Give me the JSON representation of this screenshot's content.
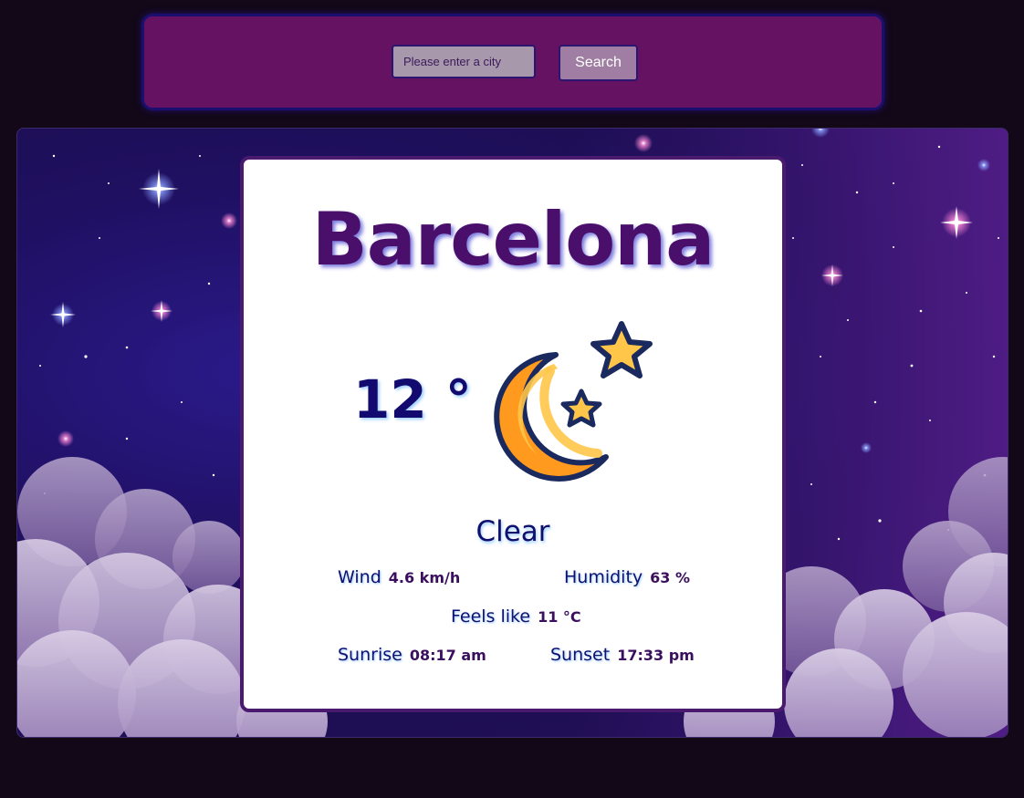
{
  "search": {
    "placeholder": "Please enter a city",
    "value": "",
    "button_label": "Search"
  },
  "weather": {
    "city": "Barcelona",
    "temperature": "12 °",
    "condition": "Clear",
    "icon": "moon-and-stars-icon",
    "details": {
      "wind_label": "Wind",
      "wind_value": "4.6 km/h",
      "humidity_label": "Humidity",
      "humidity_value": "63 %",
      "feels_like_label": "Feels like",
      "feels_like_value": "11 °C",
      "sunrise_label": "Sunrise",
      "sunrise_value": "08:17 am",
      "sunset_label": "Sunset",
      "sunset_value": "17:33 pm"
    }
  },
  "colors": {
    "page_background": "#120818",
    "search_bar": "#651263",
    "city_text": "#4a0f6a",
    "temperature_text": "#120a6e",
    "card_border": "#4a1a6e",
    "moon_orange": "#ff9a1f",
    "moon_light": "#ffc64a",
    "star_fill": "#ffc64a",
    "icon_outline": "#1a2a5e"
  }
}
